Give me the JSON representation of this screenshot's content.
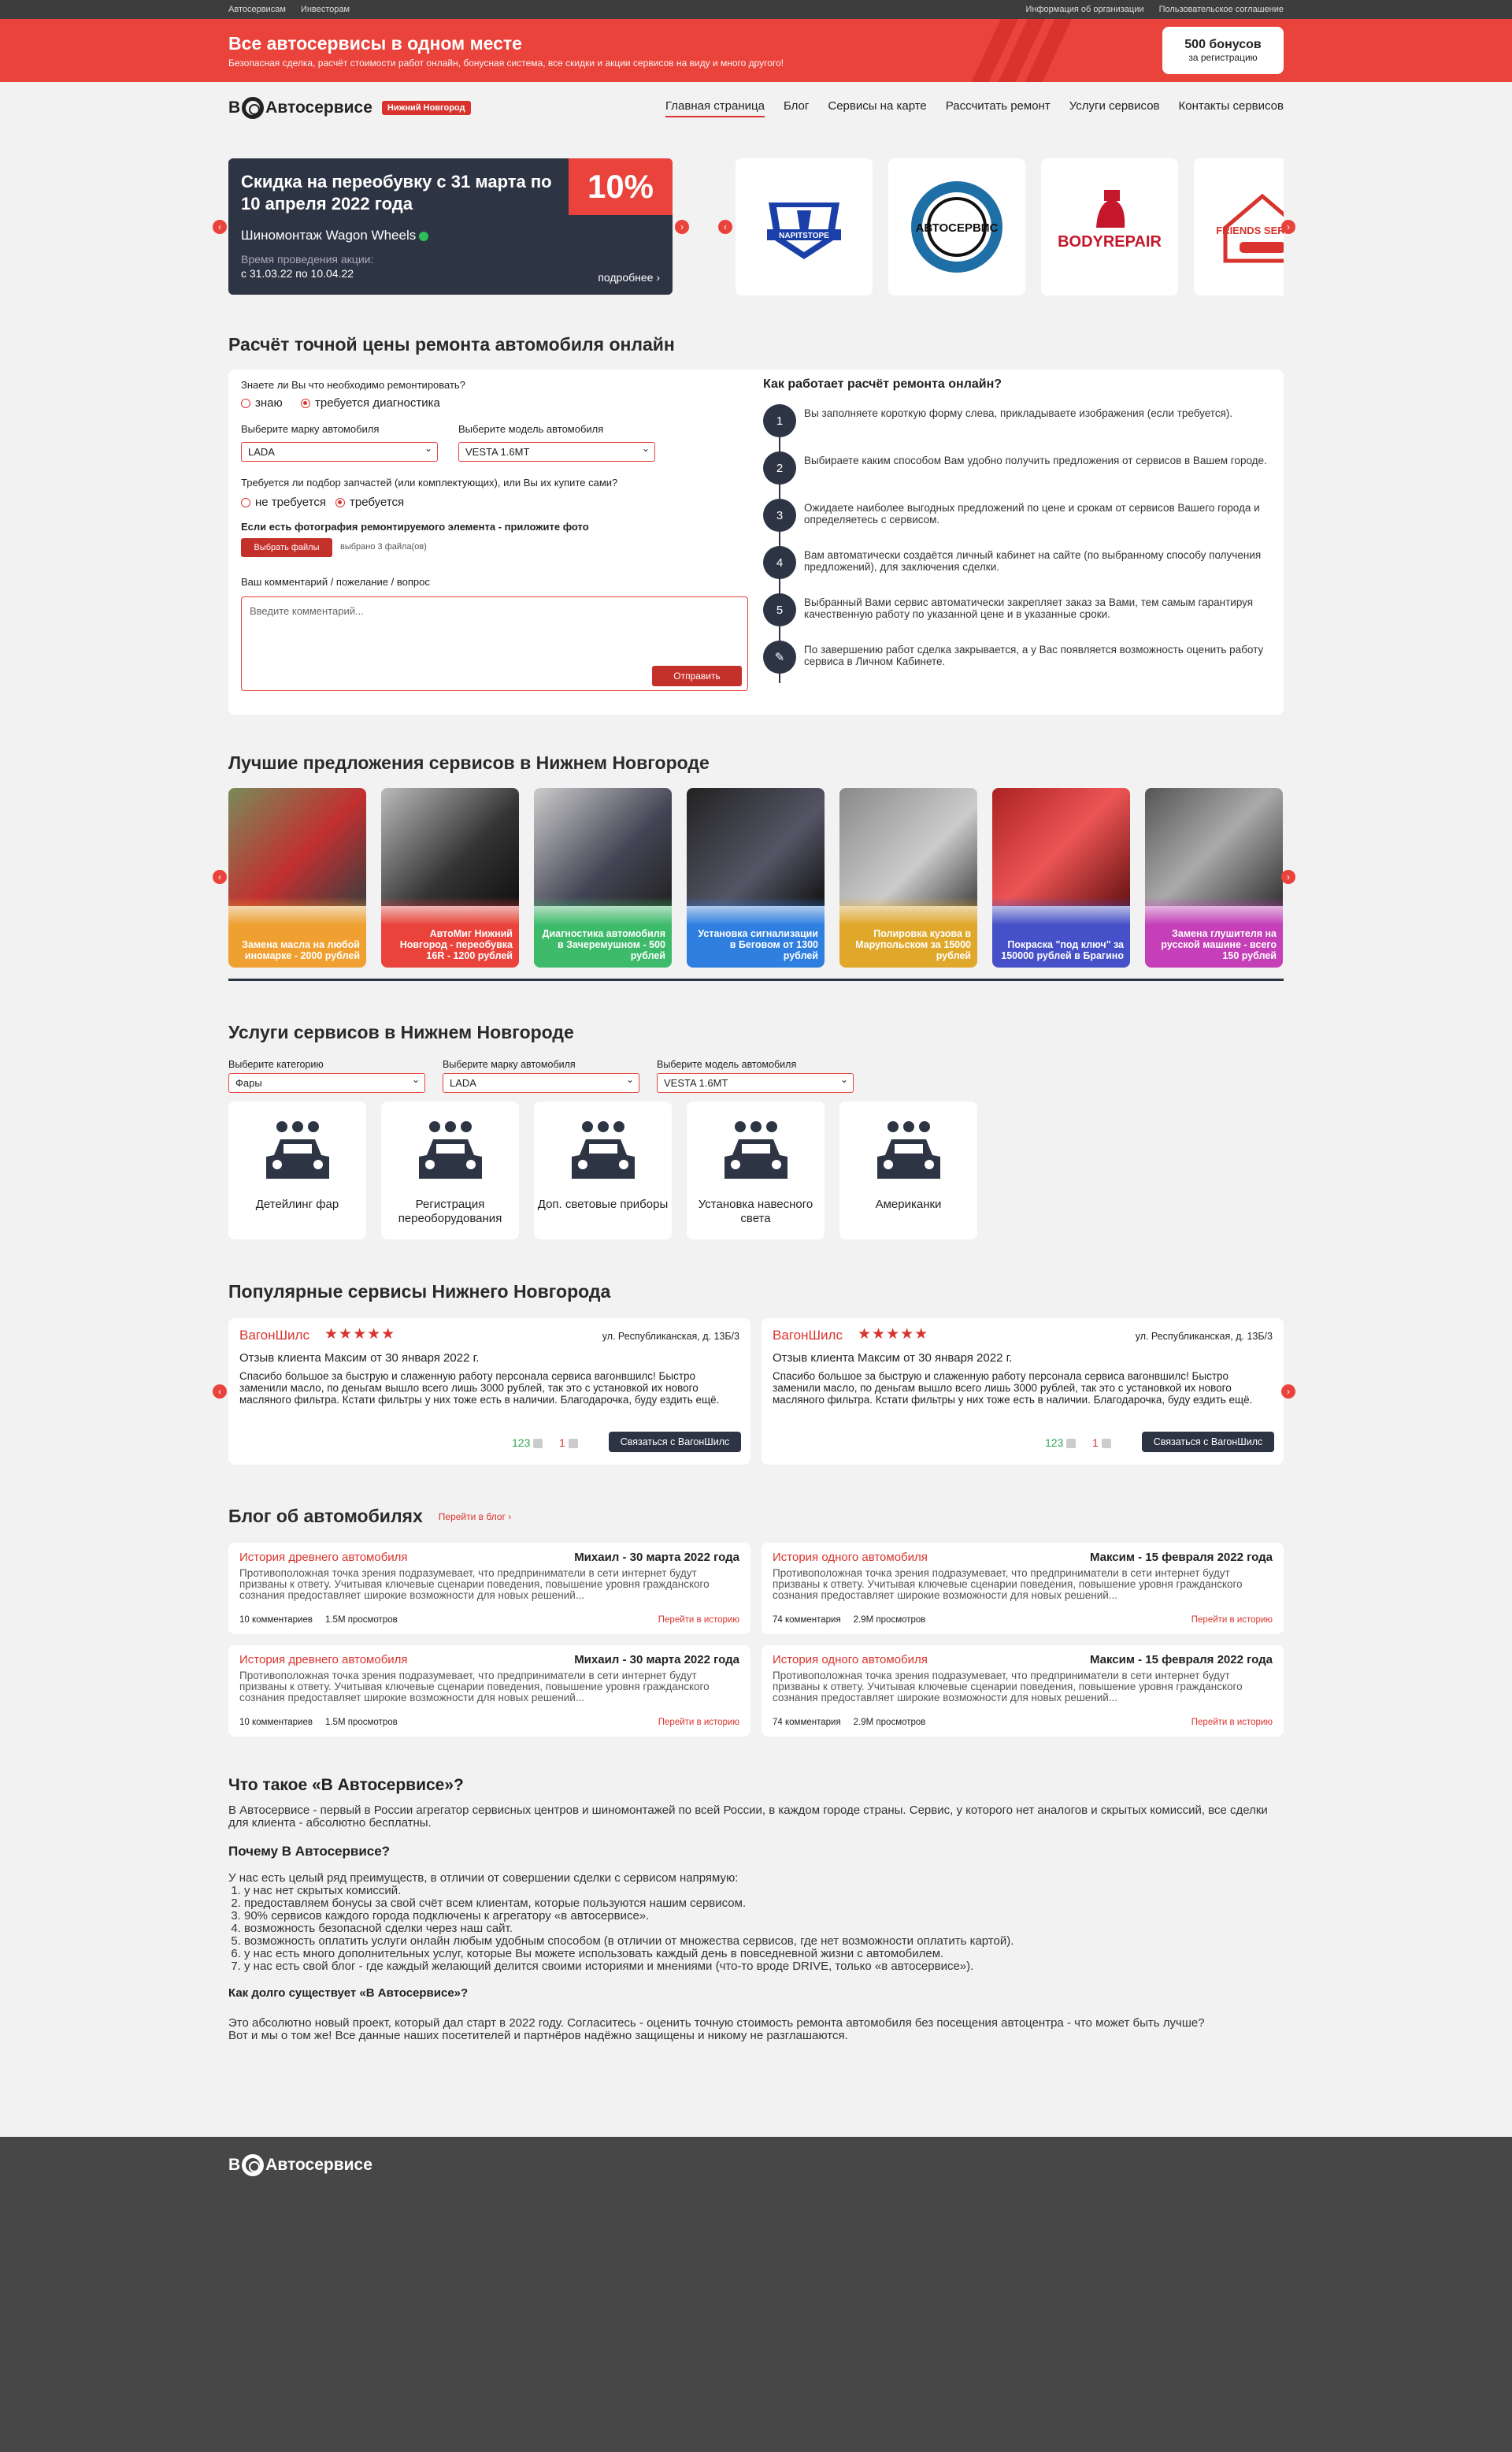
{
  "topbar": {
    "left": [
      "Автосервисам",
      "Инвесторам"
    ],
    "right": [
      "Информация об организации",
      "Пользовательское соглашение"
    ]
  },
  "banner": {
    "title": "Все автосервисы в одном месте",
    "subtitle": "Безопасная сделка, расчёт стоимости работ онлайн, бонусная система, все скидки и акции сервисов на виду и много другого!",
    "bonus_value": "500 бонусов",
    "bonus_note": "за регистрацию"
  },
  "header": {
    "logo_b": "В",
    "logo_text": "Автосервисе",
    "city": "Нижний Новгород",
    "nav": [
      "Главная страница",
      "Блог",
      "Сервисы на карте",
      "Рассчитать ремонт",
      "Услуги сервисов",
      "Контакты сервисов"
    ]
  },
  "promo": {
    "title": "Скидка на переобувку с 31 марта по 10 апреля 2022 года",
    "percent": "10%",
    "shop": "Шиномонтаж Wagon Wheels",
    "time_label": "Время проведения акции:",
    "dates": "с 31.03.22 по 10.04.22",
    "more": "подробнее ›"
  },
  "partner_logos": [
    {
      "name": "NAPITSTOPE"
    },
    {
      "name": "АВТОСЕРВИС"
    },
    {
      "name": "BODYREPAIR"
    },
    {
      "name": "FRIENDS SERVICE"
    }
  ],
  "calc": {
    "title": "Расчёт точной цены ремонта автомобиля онлайн",
    "q1": "Знаете ли Вы что необходимо ремонтировать?",
    "q1_a": "знаю",
    "q1_b": "требуется диагностика",
    "brand_label": "Выберите марку автомобиля",
    "brand_value": "LADA",
    "model_label": "Выберите модель автомобиля",
    "model_value": "VESTA 1.6MT",
    "q2": "Требуется ли подбор запчастей (или комплектующих), или Вы их купите сами?",
    "q2_a": "не требуется",
    "q2_b": "требуется",
    "photo_label": "Если есть фотография ремонтируемого элемента - приложите фото",
    "files_button": "Выбрать файлы",
    "files_chosen": "выбрано 3 файла(ов)",
    "comment_label": "Ваш комментарий / пожелание / вопрос",
    "comment_placeholder": "Введите комментарий...",
    "submit": "Отправить",
    "how_title": "Как работает расчёт ремонта онлайн?",
    "steps": [
      {
        "n": "1",
        "text": "Вы заполняете короткую форму слева, прикладываете изображения (если требуется)."
      },
      {
        "n": "2",
        "text": "Выбираете каким способом Вам удобно получить предложения от сервисов в Вашем городе."
      },
      {
        "n": "3",
        "text": "Ожидаете наиболее выгодных предложений по цене и срокам от сервисов Вашего города и определяетесь с сервисом."
      },
      {
        "n": "4",
        "text": "Вам автоматически создаётся личный кабинет на сайте (по выбранному способу получения предложений), для заключения сделки."
      },
      {
        "n": "5",
        "text": "Выбранный Вами сервис автоматически закрепляет заказ за Вами, тем самым гарантируя качественную работу по указанной цене и в указанные сроки."
      },
      {
        "n": "",
        "text": "По завершению работ сделка закрывается, а у Вас появляется возможность оценить работу сервиса в Личном Кабинете."
      }
    ]
  },
  "offers": {
    "title": "Лучшие предложения сервисов в Нижнем Новгороде",
    "items": [
      {
        "text": "Замена масла на любой иномарке - 2000 рублей",
        "color": "#f0a030"
      },
      {
        "text": "АвтоМиг Нижний Новгород - переобувка 16R - 1200 рублей",
        "color": "#e9433b"
      },
      {
        "text": "Диагностика автомобиля в Зачеремушном - 500 рублей",
        "color": "#3dbb6a"
      },
      {
        "text": "Установка сигнализации в Беговом от 1300 рублей",
        "color": "#2e7fe0"
      },
      {
        "text": "Полировка кузова в Марупольском за 15000 рублей",
        "color": "#e0a82a"
      },
      {
        "text": "Покраска \"под ключ\" за 150000 рублей в Брагино",
        "color": "#4650c8"
      },
      {
        "text": "Замена глушителя на русской машине - всего 150 рублей",
        "color": "#c43fb8"
      }
    ]
  },
  "services": {
    "title": "Услуги сервисов в Нижнем Новгороде",
    "category_label": "Выберите категорию",
    "category_value": "Фары",
    "brand_label": "Выберите марку автомобиля",
    "brand_value": "LADA",
    "model_label": "Выберите модель автомобиля",
    "model_value": "VESTA 1.6MT",
    "items": [
      "Детейлинг фар",
      "Регистрация переоборудования",
      "Доп. световые приборы",
      "Установка навесного света",
      "Американки"
    ]
  },
  "popular": {
    "title": "Популярные сервисы Нижнего Новгорода",
    "reviews": [
      {
        "name": "ВагонШилс",
        "stars": "★★★★★",
        "address": "ул. Республиканская, д. 13Б/3",
        "who": "Отзыв клиента Максим от 30 января 2022 г.",
        "text": "Спасибо большое за быструю и слаженную работу персонала сервиса вагонвшилс! Быстро заменили масло, по деньгам вышло всего лишь 3000 рублей, так это с установкой их нового масляного фильтра. Кстати фильтры у них тоже есть в наличии. Благодарочка, буду ездить ещё.",
        "likes": "123",
        "dislikes": "1",
        "button": "Связаться с ВагонШилс"
      },
      {
        "name": "ВагонШилс",
        "stars": "★★★★★",
        "address": "ул. Республиканская, д. 13Б/3",
        "who": "Отзыв клиента Максим от 30 января 2022 г.",
        "text": "Спасибо большое за быструю и слаженную работу персонала сервиса вагонвшилс! Быстро заменили масло, по деньгам вышло всего лишь 3000 рублей, так это с установкой их нового масляного фильтра. Кстати фильтры у них тоже есть в наличии. Благодарочка, буду ездить ещё.",
        "likes": "123",
        "dislikes": "1",
        "button": "Связаться с ВагонШилс"
      }
    ]
  },
  "blog": {
    "title": "Блог об автомобилях",
    "link": "Перейти в блог ›",
    "posts": [
      {
        "title": "История древнего автомобиля",
        "author": "Михаил - 30 марта 2022 года",
        "text": "Противоположная точка зрения подразумевает, что предприниматели в сети интернет будут призваны к ответу. Учитывая ключевые сценарии поведения, повышение уровня гражданского сознания предоставляет широкие возможности для новых решений...",
        "comments": "10 комментариев",
        "views": "1.5М просмотров",
        "link": "Перейти в историю"
      },
      {
        "title": "История одного автомобиля",
        "author": "Максим - 15 февраля 2022 года",
        "text": "Противоположная точка зрения подразумевает, что предприниматели в сети интернет будут призваны к ответу. Учитывая ключевые сценарии поведения, повышение уровня гражданского сознания предоставляет широкие возможности для новых решений...",
        "comments": "74 комментария",
        "views": "2.9М просмотров",
        "link": "Перейти в историю"
      },
      {
        "title": "История древнего автомобиля",
        "author": "Михаил - 30 марта 2022 года",
        "text": "Противоположная точка зрения подразумевает, что предприниматели в сети интернет будут призваны к ответу. Учитывая ключевые сценарии поведения, повышение уровня гражданского сознания предоставляет широкие возможности для новых решений...",
        "comments": "10 комментариев",
        "views": "1.5М просмотров",
        "link": "Перейти в историю"
      },
      {
        "title": "История одного автомобиля",
        "author": "Максим - 15 февраля 2022 года",
        "text": "Противоположная точка зрения подразумевает, что предприниматели в сети интернет будут призваны к ответу. Учитывая ключевые сценарии поведения, повышение уровня гражданского сознания предоставляет широкие возможности для новых решений...",
        "comments": "74 комментария",
        "views": "2.9М просмотров",
        "link": "Перейти в историю"
      }
    ]
  },
  "about": {
    "title": "Что такое «В Автосервисе»?",
    "intro": "В Автосервисе - первый в России агрегатор сервисных центров и шиномонтажей по всей России, в каждом городе страны. Сервис, у которого нет аналогов и скрытых комиссий, все сделки для клиента - абсолютно бесплатны.",
    "why_title": "Почему В Автосервисе?",
    "why_intro": "У нас есть целый ряд преимуществ, в отличии от совершении сделки с сервисом напрямую:",
    "why_list": [
      "у нас нет скрытых комиссий.",
      "предоставляем бонусы за свой счёт всем клиентам, которые пользуются нашим сервисом.",
      "90% сервисов каждого города подключены к агрегатору «в автосервисе».",
      "возможность безопасной сделки через наш сайт.",
      "возможность оплатить услуги онлайн любым удобным способом (в отличии от множества сервисов, где нет возможности оплатить картой).",
      "у нас есть много дополнительных услуг, которые Вы можете использовать каждый день в повседневной жизни с автомобилем.",
      "у нас есть свой блог - где каждый желающий делится своими историями и мнениями (что-то вроде DRIVE, только «в автосервисе»)."
    ],
    "how_long_title": "Как долго существует «В Автосервисе»?",
    "how_long_text": "Это абсолютно новый проект, который дал старт в 2022 году. Согласитесь - оценить точную стоимость ремонта автомобиля без посещения автоцентра - что может быть лучше?",
    "closing": "Вот и мы о том же! Все данные наших посетителей и партнёров надёжно защищены и никому не разглашаются."
  },
  "footer": {
    "logo_b": "В",
    "logo_text": "Автосервисе"
  }
}
